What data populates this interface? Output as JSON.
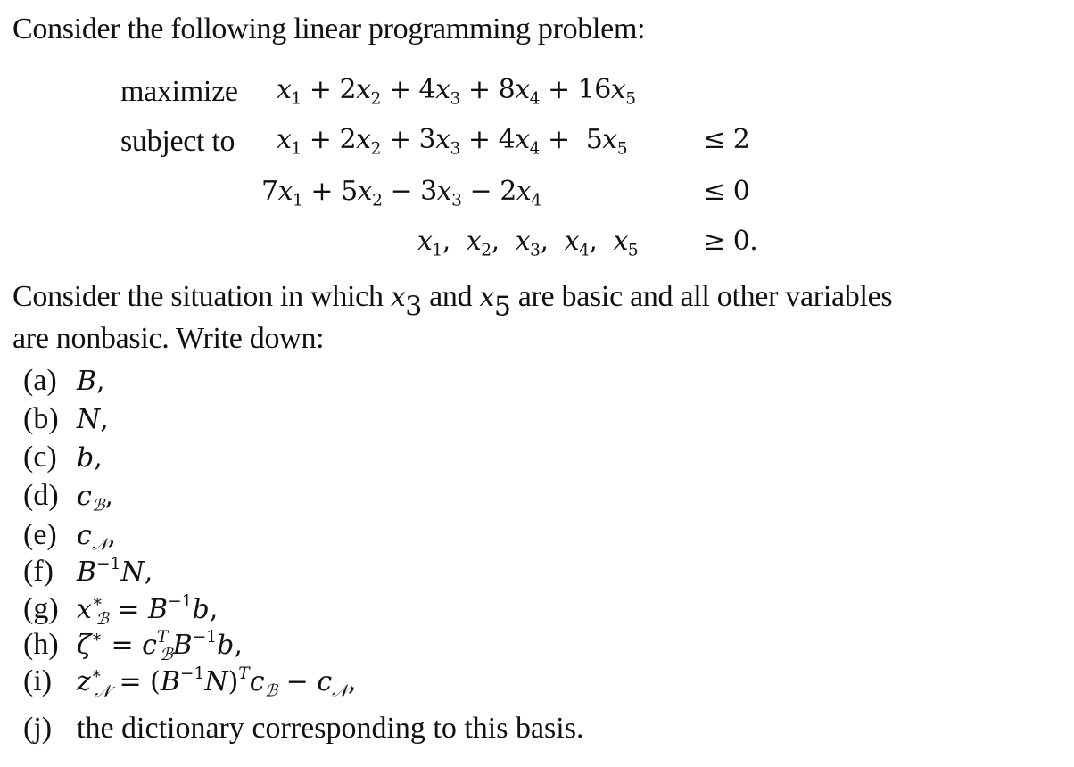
{
  "document": {
    "intro": "Consider the following linear programming problem:",
    "lp": {
      "objective_label": "maximize",
      "constraint_label": "subject to",
      "objective": {
        "terms": [
          {
            "coef": "",
            "var": "x",
            "idx": "1"
          },
          {
            "op": "+",
            "coef": "2",
            "var": "x",
            "idx": "2"
          },
          {
            "op": "+",
            "coef": "4",
            "var": "x",
            "idx": "3"
          },
          {
            "op": "+",
            "coef": "8",
            "var": "x",
            "idx": "4"
          },
          {
            "op": "+",
            "coef": "16",
            "var": "x",
            "idx": "5"
          }
        ],
        "text": "x1 + 2x2 + 4x3 + 8x4 + 16x5"
      },
      "constraints": [
        {
          "lhs": "x1 + 2x2 + 3x3 + 4x4 + 5x5",
          "relation": "≤",
          "rhs": "2"
        },
        {
          "lhs": "7x1 + 5x2 − 3x3 − 2x4",
          "relation": "≤",
          "rhs": "0"
        },
        {
          "lhs": "x1, x2, x3, x4, x5",
          "relation": "≥",
          "rhs": "0."
        }
      ]
    },
    "paragraph": {
      "line1_a": "Consider the situation in which",
      "var1": "x",
      "var1_idx": "3",
      "line1_b": "and",
      "var2": "x",
      "var2_idx": "5",
      "line1_c": "are basic and all other variables",
      "line2": "are nonbasic. Write down:"
    },
    "items": [
      {
        "label": "(a)",
        "expr": "B,"
      },
      {
        "label": "(b)",
        "expr": "N,"
      },
      {
        "label": "(c)",
        "expr": "b,"
      },
      {
        "label": "(d)",
        "expr": "c_B,"
      },
      {
        "label": "(e)",
        "expr": "c_N,"
      },
      {
        "label": "(f)",
        "expr": "B^{-1}N,"
      },
      {
        "label": "(g)",
        "expr": "x*_B = B^{-1}b,"
      },
      {
        "label": "(h)",
        "expr": "ζ* = c_B^T B^{-1}b,"
      },
      {
        "label": "(i)",
        "expr": "z*_N = (B^{-1}N)^T c_B − c_N,"
      },
      {
        "label": "(j)",
        "expr": "the dictionary corresponding to this basis."
      }
    ],
    "symbols": {
      "B": "B",
      "N": "N",
      "b": "b",
      "c": "c",
      "x": "x",
      "z": "z",
      "zeta": "ζ",
      "star": "∗",
      "inv": "−1",
      "T": "T",
      "calB": "ℬ",
      "calN": "𝒩",
      "eq": "=",
      "minus": "−",
      "plus": "+",
      "comma": ",",
      "lparen": "(",
      "rparen": ")",
      "item_j_text": "the dictionary corresponding to this basis."
    }
  }
}
